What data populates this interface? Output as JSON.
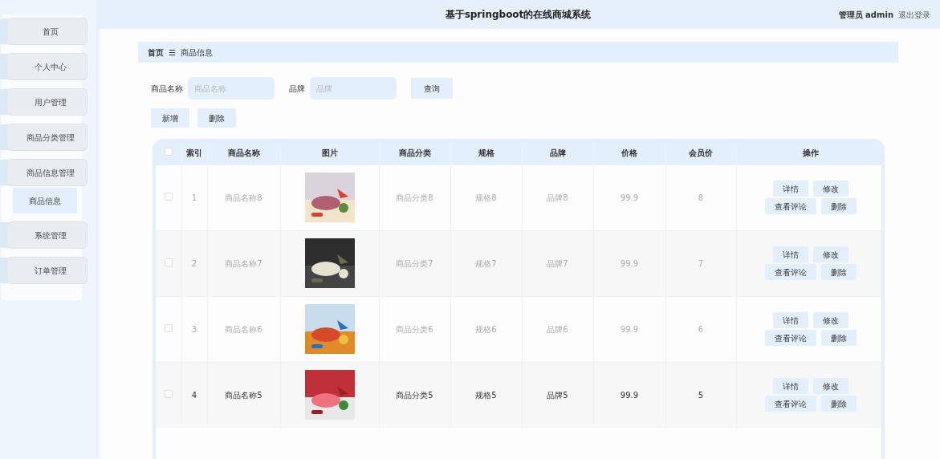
{
  "header": {
    "title": "基于springboot的在线商城系统",
    "user": "管理员 admin",
    "logout": "退出登录"
  },
  "sidebar": {
    "items": [
      {
        "label": "首页"
      },
      {
        "label": "个人中心"
      },
      {
        "label": "用户管理"
      },
      {
        "label": "商品分类管理"
      },
      {
        "label": "商品信息管理",
        "children": [
          {
            "label": "商品信息",
            "selected": true
          }
        ]
      },
      {
        "label": "系统管理"
      },
      {
        "label": "订单管理"
      }
    ]
  },
  "breadcrumb": {
    "home": "首页",
    "separator": "☰",
    "current": "商品信息"
  },
  "search": {
    "fields": [
      {
        "label": "商品名称",
        "placeholder": "商品名称"
      },
      {
        "label": "品牌",
        "placeholder": "品牌"
      }
    ],
    "button": "查询"
  },
  "actions": [
    "新增",
    "删除"
  ],
  "table": {
    "all_selected": false,
    "columns": [
      "索引",
      "商品名称",
      "图片",
      "商品分类",
      "规格",
      "品牌",
      "价格",
      "会员价",
      "操作"
    ],
    "rows": [
      {
        "selected": false,
        "highlighted": false,
        "cells": [
          "1",
          "商品名称8",
          {
            "kind": "picture"
          },
          "商品分类8",
          "规格8",
          "品牌8",
          "99.9",
          "8",
          {
            "buttons": [
              [
                "详情",
                "修改"
              ],
              [
                "查看评论",
                "删除"
              ]
            ]
          }
        ]
      },
      {
        "selected": false,
        "highlighted": false,
        "cells": [
          "2",
          "商品名称7",
          {
            "kind": "picture"
          },
          "商品分类7",
          "规格7",
          "品牌7",
          "99.9",
          "7",
          {
            "buttons": [
              [
                "详情",
                "修改"
              ],
              [
                "查看评论",
                "删除"
              ]
            ]
          }
        ]
      },
      {
        "selected": false,
        "highlighted": false,
        "cells": [
          "3",
          "商品名称6",
          {
            "kind": "picture"
          },
          "商品分类6",
          "规格6",
          "品牌6",
          "99.9",
          "6",
          {
            "buttons": [
              [
                "详情",
                "修改"
              ],
              [
                "查看评论",
                "删除"
              ]
            ]
          }
        ]
      },
      {
        "selected": false,
        "highlighted": true,
        "cells": [
          "4",
          "商品名称5",
          {
            "kind": "picture"
          },
          "商品分类5",
          "规格5",
          "品牌5",
          "99.9",
          "5",
          {
            "buttons": [
              [
                "详情",
                "修改"
              ],
              [
                "查看评论",
                "删除"
              ]
            ]
          }
        ]
      }
    ]
  }
}
